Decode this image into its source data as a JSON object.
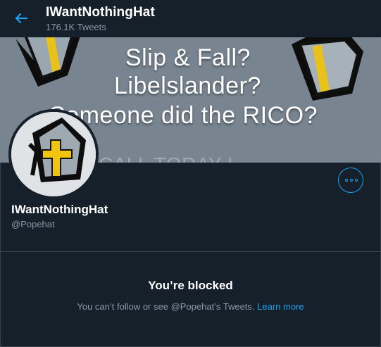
{
  "header": {
    "title": "IWantNothingHat",
    "tweet_count": "176.1K Tweets"
  },
  "banner": {
    "line1": "Slip & Fall?",
    "line2": "Libelslander?",
    "line3": "Someone did the RICO?",
    "line4": "CALL TODAY !"
  },
  "profile": {
    "name": "IWantNothingHat",
    "handle": "@Popehat"
  },
  "blocked": {
    "title": "You’re blocked",
    "message": "You can’t follow or see @Popehat’s Tweets.",
    "link": "Learn more"
  },
  "colors": {
    "background": "#15202b",
    "accent": "#1da1f2",
    "secondary_text": "#8899a6",
    "border": "#38444d"
  }
}
